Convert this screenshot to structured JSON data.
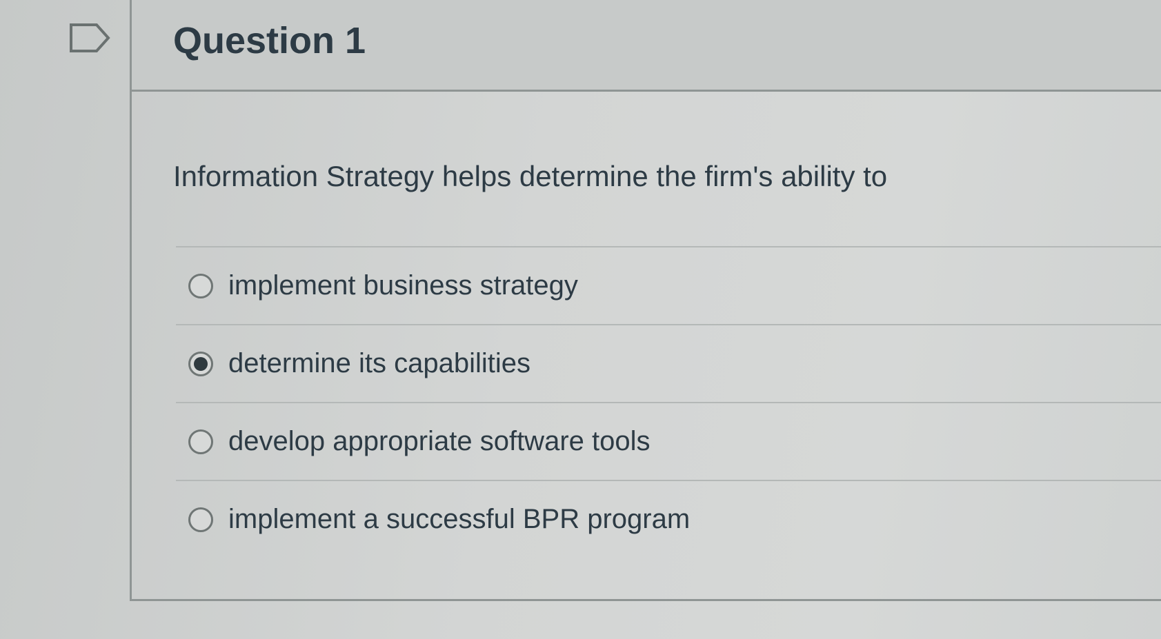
{
  "question": {
    "title": "Question 1",
    "prompt": "Information Strategy helps determine the firm's ability to",
    "flag_icon": "bookmark-flag-icon",
    "answers": [
      {
        "label": "implement business strategy",
        "selected": false
      },
      {
        "label": "determine its capabilities",
        "selected": true
      },
      {
        "label": "develop appropriate software tools",
        "selected": false
      },
      {
        "label": "implement a successful BPR program",
        "selected": false
      }
    ]
  },
  "colors": {
    "text": "#2d3b45",
    "border": "#8f9594",
    "radio_selected": "#2f3a3f"
  }
}
